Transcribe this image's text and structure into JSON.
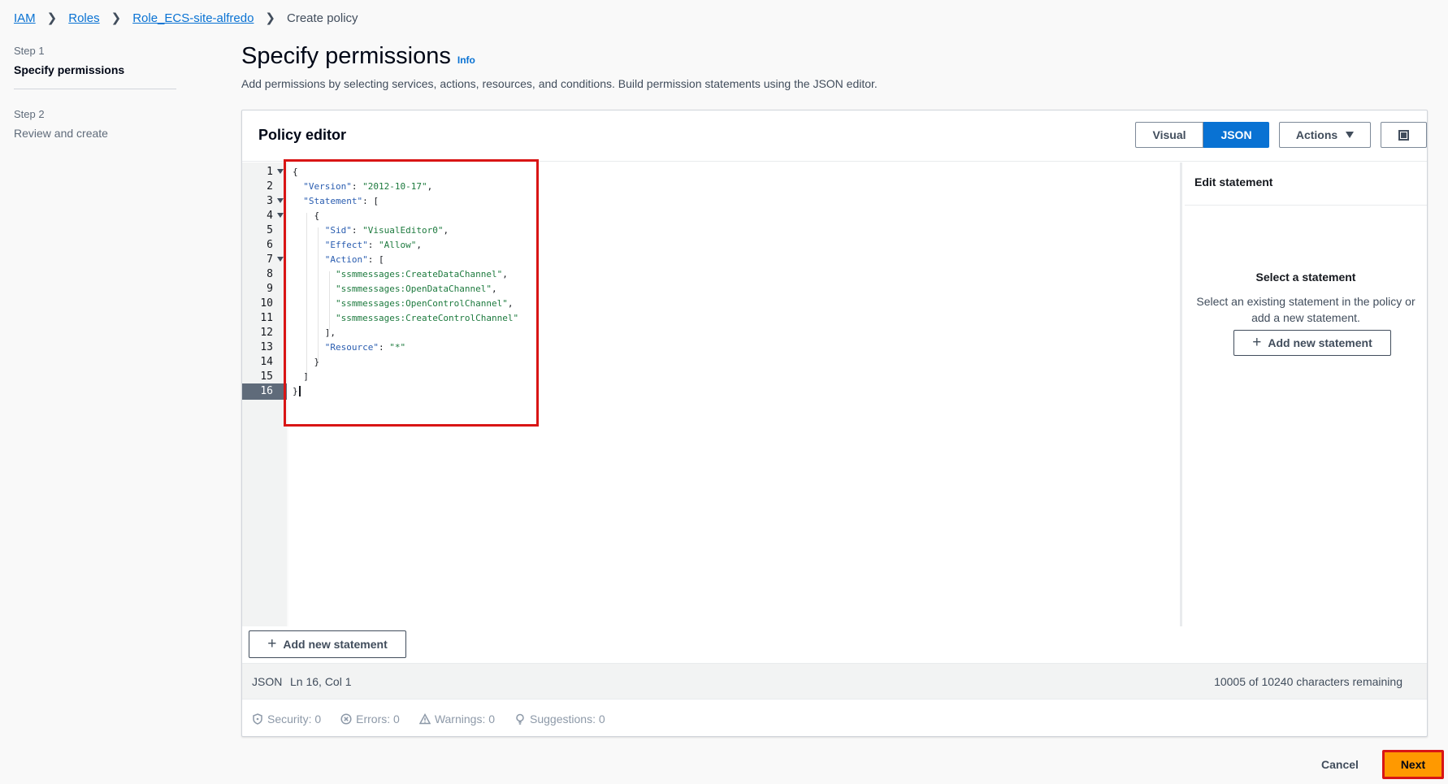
{
  "breadcrumb": {
    "items": [
      "IAM",
      "Roles",
      "Role_ECS-site-alfredo"
    ],
    "current": "Create policy"
  },
  "steps": [
    {
      "num": "Step 1",
      "title": "Specify permissions"
    },
    {
      "num": "Step 2",
      "title": "Review and create"
    }
  ],
  "header": {
    "title": "Specify permissions",
    "info": "Info",
    "description": "Add permissions by selecting services, actions, resources, and conditions. Build permission statements using the JSON editor."
  },
  "panel": {
    "title": "Policy editor",
    "visual_label": "Visual",
    "json_label": "JSON",
    "actions_label": "Actions",
    "add_statement": "Add new statement"
  },
  "editor": {
    "line_numbers": [
      "1",
      "2",
      "3",
      "4",
      "5",
      "6",
      "7",
      "8",
      "9",
      "10",
      "11",
      "12",
      "13",
      "14",
      "15",
      "16"
    ],
    "code": {
      "brace_open": "{",
      "version_key": "\"Version\"",
      "version_val": "\"2012-10-17\"",
      "statement_key": "\"Statement\"",
      "sid_key": "\"Sid\"",
      "sid_val": "\"VisualEditor0\"",
      "effect_key": "\"Effect\"",
      "effect_val": "\"Allow\"",
      "action_key": "\"Action\"",
      "actions": [
        "\"ssmmessages:CreateDataChannel\"",
        "\"ssmmessages:OpenDataChannel\"",
        "\"ssmmessages:OpenControlChannel\"",
        "\"ssmmessages:CreateControlChannel\""
      ],
      "resource_key": "\"Resource\"",
      "resource_val": "\"*\"",
      "brace_close": "}"
    }
  },
  "side": {
    "title": "Edit statement",
    "empty_title": "Select a statement",
    "empty_text": "Select an existing statement in the policy or add a new statement.",
    "add_statement": "Add new statement"
  },
  "status": {
    "language": "JSON",
    "position": "Ln 16, Col 1",
    "remaining": "10005 of 10240 characters remaining"
  },
  "validation": [
    {
      "icon": "shield-icon",
      "label": "Security: 0"
    },
    {
      "icon": "error-icon",
      "label": "Errors: 0"
    },
    {
      "icon": "warning-icon",
      "label": "Warnings: 0"
    },
    {
      "icon": "lightbulb-icon",
      "label": "Suggestions: 0"
    }
  ],
  "footer": {
    "cancel": "Cancel",
    "next": "Next"
  },
  "colors": {
    "primary": "#0972d3",
    "next_button": "#ff9900",
    "highlight": "#d91515"
  }
}
